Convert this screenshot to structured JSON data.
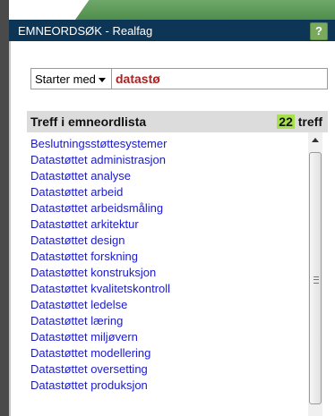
{
  "header": {
    "title": "EMNEORDSØK - Realfag",
    "help_label": "?"
  },
  "search": {
    "mode_selected": "Starter med",
    "query": "datastø"
  },
  "results": {
    "heading": "Treff i emneordlista",
    "count": "22",
    "count_suffix": "treff",
    "items": [
      "Beslutningsstøttesystemer",
      "Datastøttet administrasjon",
      "Datastøttet analyse",
      "Datastøttet arbeid",
      "Datastøttet arbeidsmåling",
      "Datastøttet arkitektur",
      "Datastøttet design",
      "Datastøttet forskning",
      "Datastøttet konstruksjon",
      "Datastøttet kvalitetskontroll",
      "Datastøttet ledelse",
      "Datastøttet læring",
      "Datastøttet miljøvern",
      "Datastøttet modellering",
      "Datastøttet oversetting",
      "Datastøttet produksjon"
    ]
  },
  "colors": {
    "header_bg": "#0d3556",
    "link": "#1a1acc",
    "query": "#b02020",
    "count_highlight": "#a6e04a",
    "accent_green": "#5c9a55"
  },
  "icons": {
    "help": "help-icon",
    "dropdown": "chevron-down-icon",
    "scroll_up": "arrow-up-icon"
  }
}
